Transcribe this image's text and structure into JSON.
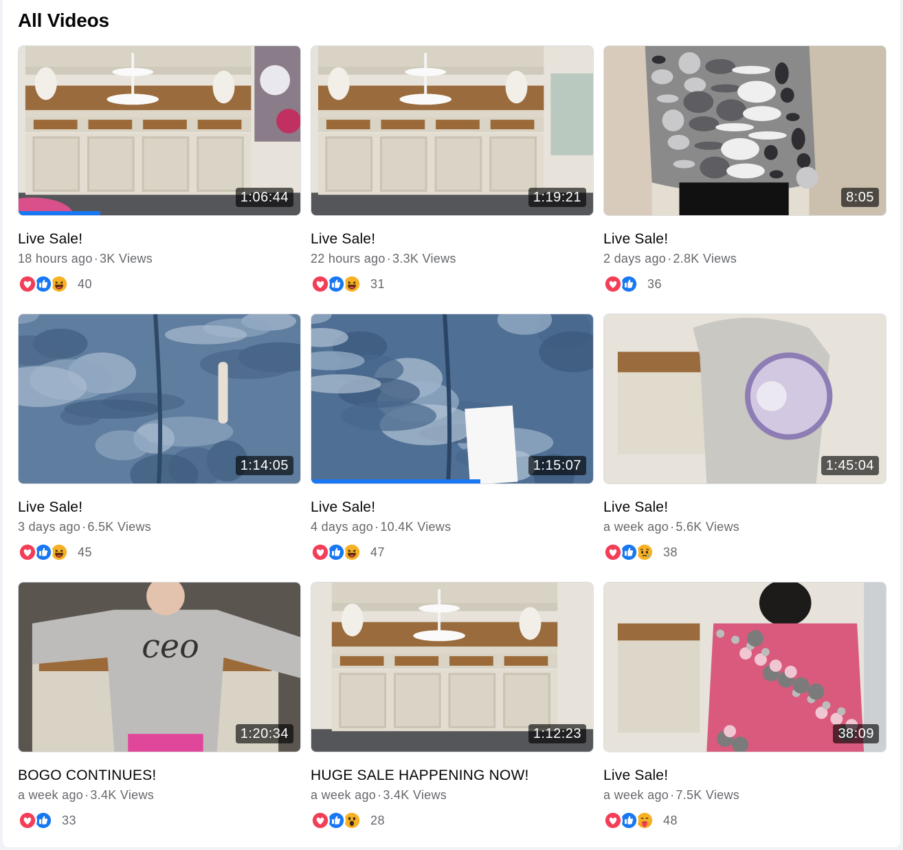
{
  "section": {
    "title": "All Videos"
  },
  "colors": {
    "accent": "#1877f2",
    "meta": "#65676b",
    "love": "#f33e58",
    "like": "#1877f2",
    "haha": "#f7b125"
  },
  "videos": [
    {
      "thumb": "hutch",
      "duration": "1:06:44",
      "progress": 0.29,
      "title": "Live Sale!",
      "time": "18 hours ago",
      "views": "3K Views",
      "reactions": [
        "love-icon",
        "like-icon",
        "haha-icon"
      ],
      "count": "40"
    },
    {
      "thumb": "hutch2",
      "duration": "1:19:21",
      "progress": 0,
      "title": "Live Sale!",
      "time": "22 hours ago",
      "views": "3.3K Views",
      "reactions": [
        "love-icon",
        "like-icon",
        "haha-icon"
      ],
      "count": "31"
    },
    {
      "thumb": "camo",
      "duration": "8:05",
      "progress": 0,
      "title": "Live Sale!",
      "time": "2 days ago",
      "views": "2.8K Views",
      "reactions": [
        "love-icon",
        "like-icon"
      ],
      "count": "36"
    },
    {
      "thumb": "denim",
      "duration": "1:14:05",
      "progress": 0,
      "title": "Live Sale!",
      "time": "3 days ago",
      "views": "6.5K Views",
      "reactions": [
        "love-icon",
        "like-icon",
        "haha-icon"
      ],
      "count": "45"
    },
    {
      "thumb": "denim2",
      "duration": "1:15:07",
      "progress": 0.6,
      "title": "Live Sale!",
      "time": "4 days ago",
      "views": "10.4K Views",
      "reactions": [
        "love-icon",
        "like-icon",
        "haha-icon"
      ],
      "count": "47"
    },
    {
      "thumb": "tee",
      "duration": "1:45:04",
      "progress": 0,
      "title": "Live Sale!",
      "time": "a week ago",
      "views": "5.6K Views",
      "reactions": [
        "love-icon",
        "like-icon",
        "sad-icon"
      ],
      "count": "38"
    },
    {
      "thumb": "ceo",
      "duration": "1:20:34",
      "progress": 0,
      "title": "BOGO CONTINUES!",
      "time": "a week ago",
      "views": "3.4K Views",
      "reactions": [
        "love-icon",
        "like-icon"
      ],
      "count": "33"
    },
    {
      "thumb": "hutch3",
      "duration": "1:12:23",
      "progress": 0,
      "title": "HUGE SALE HAPPENING NOW!",
      "time": "a week ago",
      "views": "3.4K Views",
      "reactions": [
        "love-icon",
        "like-icon",
        "wow-icon"
      ],
      "count": "28"
    },
    {
      "thumb": "floral",
      "duration": "38:09",
      "progress": 0,
      "title": "Live Sale!",
      "time": "a week ago",
      "views": "7.5K Views",
      "reactions": [
        "love-icon",
        "like-icon",
        "care-icon"
      ],
      "count": "48"
    }
  ]
}
